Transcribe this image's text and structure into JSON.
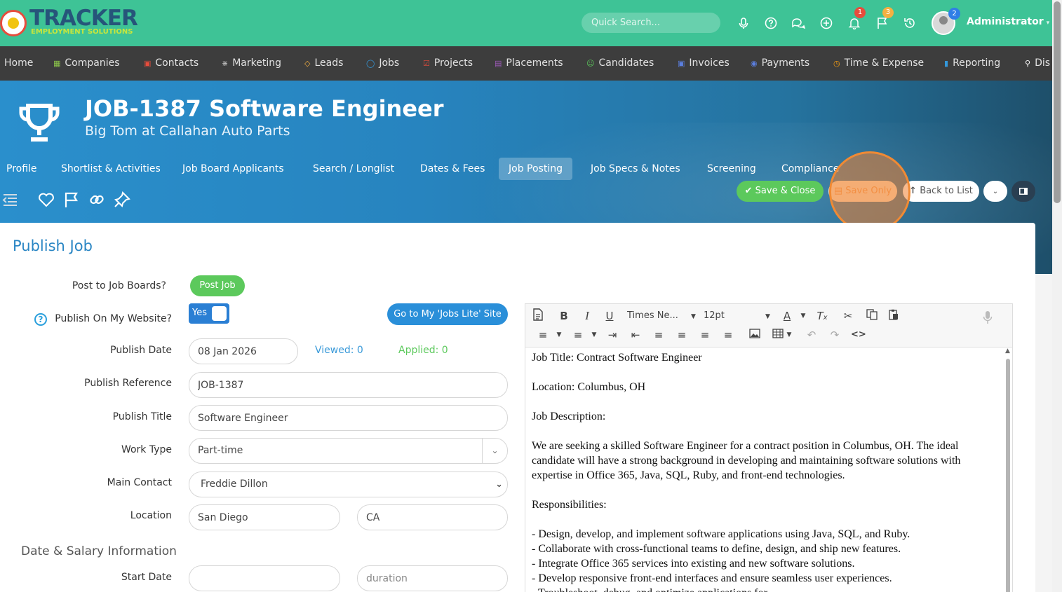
{
  "brand": {
    "name": "TRACKER",
    "tagline": "EMPLOYMENT SOLUTIONS"
  },
  "topbar": {
    "search_placeholder": "Quick Search...",
    "badges": {
      "notifications": "1",
      "flags": "3",
      "avatar": "2"
    },
    "user_name": "Administrator"
  },
  "nav": {
    "items": [
      {
        "label": "Home",
        "icon": "home-icon",
        "color": "#e2e2e2"
      },
      {
        "label": "Companies",
        "icon": "companies-icon",
        "color": "#8bc34a"
      },
      {
        "label": "Contacts",
        "icon": "contacts-icon",
        "color": "#e74c3c"
      },
      {
        "label": "Marketing",
        "icon": "marketing-icon",
        "color": "#bbbbbb"
      },
      {
        "label": "Leads",
        "icon": "leads-icon",
        "color": "#f5b041"
      },
      {
        "label": "Jobs",
        "icon": "jobs-icon",
        "color": "#3498db"
      },
      {
        "label": "Projects",
        "icon": "projects-icon",
        "color": "#e74c3c"
      },
      {
        "label": "Placements",
        "icon": "placements-icon",
        "color": "#9b59b6"
      },
      {
        "label": "Candidates",
        "icon": "candidates-icon",
        "color": "#5cc95c"
      },
      {
        "label": "Invoices",
        "icon": "invoices-icon",
        "color": "#5b7fe0"
      },
      {
        "label": "Payments",
        "icon": "payments-icon",
        "color": "#5b7fe0"
      },
      {
        "label": "Time & Expense",
        "icon": "time-expense-icon",
        "color": "#f39c12"
      },
      {
        "label": "Reporting",
        "icon": "reporting-icon",
        "color": "#3498db"
      },
      {
        "label": "Dis",
        "icon": "search-icon",
        "color": "#ffffff"
      }
    ]
  },
  "header": {
    "title": "JOB-1387 Software Engineer",
    "subtitle": "Big Tom at Callahan Auto Parts",
    "tabs": [
      {
        "label": "Profile"
      },
      {
        "label": "Shortlist & Activities"
      },
      {
        "label": "Job Board Applicants"
      },
      {
        "label": "Search / Longlist"
      },
      {
        "label": "Dates & Fees"
      },
      {
        "label": "Job Posting"
      },
      {
        "label": "Job Specs & Notes"
      },
      {
        "label": "Screening"
      },
      {
        "label": "Compliance"
      }
    ],
    "active_tab": "Job Posting",
    "buttons": {
      "save_close": "Save & Close",
      "save_only": "Save Only",
      "back": "Back to List"
    }
  },
  "form": {
    "section_title": "Publish Job",
    "post_to_boards_label": "Post to Job Boards?",
    "post_job_button": "Post Job",
    "publish_website_label": "Publish On My Website?",
    "publish_website_toggle": "Yes",
    "jobs_lite_button": "Go to My 'Jobs Lite' Site",
    "publish_date_label": "Publish Date",
    "publish_date": "08 Jan 2026",
    "viewed": "Viewed: 0",
    "applied": "Applied: 0",
    "publish_reference_label": "Publish Reference",
    "publish_reference": "JOB-1387",
    "publish_title_label": "Publish Title",
    "publish_title": "Software Engineer",
    "work_type_label": "Work Type",
    "work_type": "Part-time",
    "main_contact_label": "Main Contact",
    "main_contact": "Freddie Dillon",
    "location_label": "Location",
    "location_city": "San Diego",
    "location_state": "CA",
    "section2_title": "Date & Salary Information",
    "start_date_label": "Start Date",
    "start_date": "",
    "duration_placeholder": "duration"
  },
  "editor": {
    "font_name": "Times Ne...",
    "font_size": "12pt",
    "paragraphs": [
      "Job Title: Contract Software Engineer",
      "",
      "Location: Columbus, OH",
      "",
      "Job Description:",
      "",
      "We are seeking a skilled Software Engineer for a contract position in Columbus, OH. The ideal candidate will have a strong background in developing and maintaining software solutions with expertise in Office 365, Java, SQL, Ruby, and front-end technologies.",
      "",
      "Responsibilities:",
      "",
      "- Design, develop, and implement software applications using Java, SQL, and Ruby.",
      "- Collaborate with cross-functional teams to define, design, and ship new features.",
      "- Integrate Office 365 services into existing and new software solutions.",
      "- Develop responsive front-end interfaces and ensure seamless user experiences.",
      "- Troubleshoot, debug, and optimize applications for"
    ]
  }
}
